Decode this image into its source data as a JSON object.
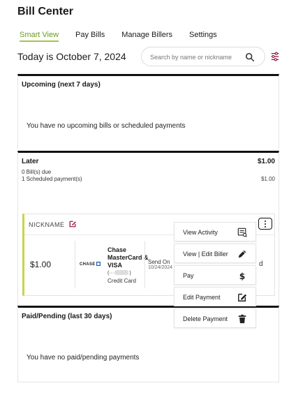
{
  "page": {
    "title": "Bill Center"
  },
  "tabs": [
    {
      "label": "Smart View",
      "active": true
    },
    {
      "label": "Pay Bills",
      "active": false
    },
    {
      "label": "Manage Billers",
      "active": false
    },
    {
      "label": "Settings",
      "active": false
    }
  ],
  "header": {
    "today_text": "Today is October 7, 2024"
  },
  "search": {
    "placeholder": "Search by name or nickname",
    "value": ""
  },
  "upcoming": {
    "title": "Upcoming (next 7 days)",
    "message": "You have no upcoming bills or scheduled payments"
  },
  "later": {
    "title": "Later",
    "amount": "$1.00",
    "bills_due": "0 Bill(s) due",
    "scheduled": "1 Scheduled payment(s)",
    "scheduled_amount": "$1.00",
    "card": {
      "nickname": "NICKNAME",
      "amount": "$1.00",
      "logo_text": "CHASE",
      "biller_name": "Chase MasterCard & VISA",
      "account_mask": "(···",
      "account_mask_end": ")",
      "account_type": "Credit Card",
      "send_label": "Send On",
      "send_date": "10/24/2024",
      "status_fragment": "d"
    }
  },
  "menu": {
    "items": [
      {
        "label": "View Activity",
        "icon": "activity-icon"
      },
      {
        "label": "View | Edit Biller",
        "icon": "pencil-icon"
      },
      {
        "label": "Pay",
        "icon": "dollar-icon"
      },
      {
        "label": "Edit Payment",
        "icon": "edit-square-icon"
      },
      {
        "label": "Delete Payment",
        "icon": "trash-icon"
      }
    ]
  },
  "paid": {
    "title": "Paid/Pending (last 30 days)",
    "message": "You have no paid/pending payments"
  },
  "colors": {
    "accent": "#a7c24a",
    "accent_text": "#6a9a1f",
    "edit_icon": "#9c1f4a"
  }
}
